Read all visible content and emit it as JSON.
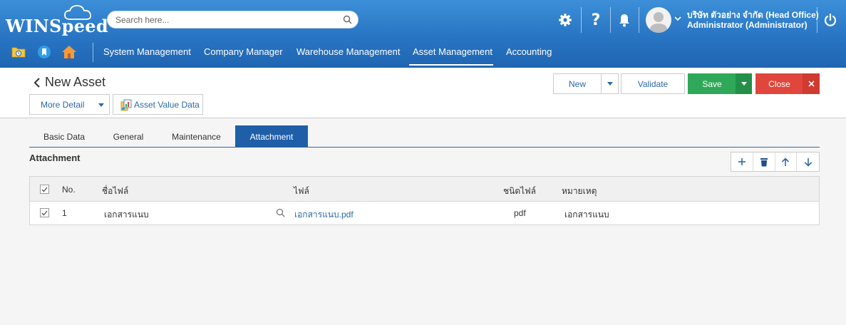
{
  "app": {
    "logo": "WINSpeed",
    "brand_color": "#2a77c5"
  },
  "search": {
    "placeholder": "Search here..."
  },
  "header": {
    "icons": [
      "gear-icon",
      "help-icon",
      "bell-icon",
      "power-icon"
    ],
    "company": "บริษัท ตัวอย่าง จำกัด (Head Office)",
    "user": "Administrator (Administrator)"
  },
  "menu": {
    "quick_icons": [
      "folder-clock-icon",
      "bookmark-icon",
      "home-icon"
    ],
    "items": [
      {
        "label": "System Management"
      },
      {
        "label": "Company Manager"
      },
      {
        "label": "Warehouse Management"
      },
      {
        "label": "Asset Management",
        "active": true
      },
      {
        "label": "Accounting"
      }
    ]
  },
  "page": {
    "title": "New Asset",
    "more_detail": "More Detail",
    "asset_value": "Asset Value Data",
    "actions": {
      "new": "New",
      "validate": "Validate",
      "save": "Save",
      "close": "Close"
    }
  },
  "tabs": [
    {
      "label": "Basic Data"
    },
    {
      "label": "General"
    },
    {
      "label": "Maintenance"
    },
    {
      "label": "Attachment",
      "active": true
    }
  ],
  "attachment": {
    "title": "Attachment",
    "tools": [
      "add-icon",
      "delete-icon",
      "move-up-icon",
      "move-down-icon"
    ],
    "columns": {
      "no": "No.",
      "file_name": "ชื่อไฟล์",
      "file": "ไฟล์",
      "file_type": "ชนิดไฟล์",
      "remark": "หมายเหตุ"
    },
    "rows": [
      {
        "checked": true,
        "no": "1",
        "file_name": "เอกสารแนบ",
        "file": "เอกสารแนบ.pdf",
        "file_type": "pdf",
        "remark": "เอกสารแนบ"
      }
    ]
  }
}
